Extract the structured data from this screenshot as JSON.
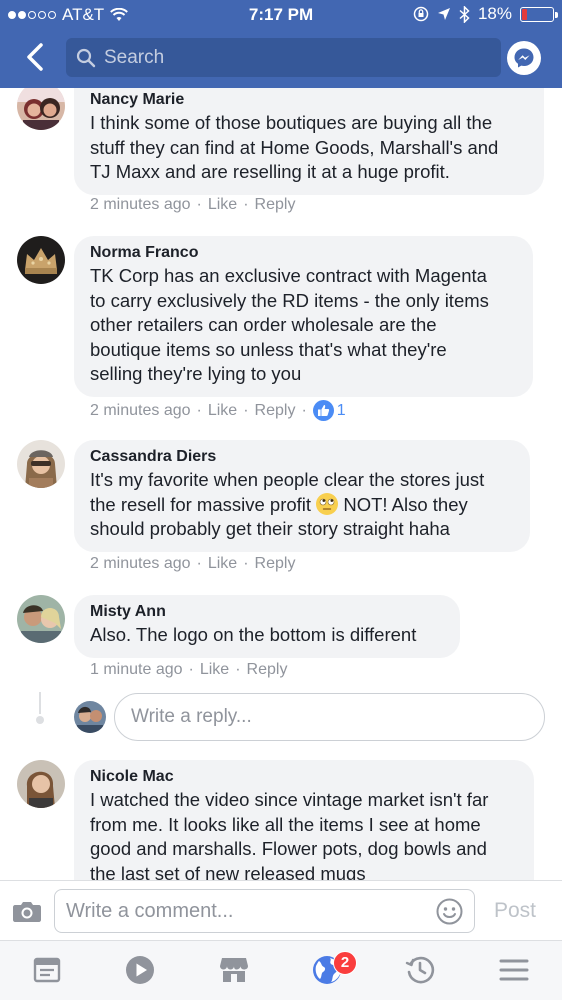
{
  "status_bar": {
    "carrier": "AT&T",
    "time": "7:17 PM",
    "battery": "18%",
    "battery_level": 0.18
  },
  "header": {
    "search_placeholder": "Search"
  },
  "comments": [
    {
      "name": "Nancy Marie",
      "text_lines": [
        "I think some of those boutiques are buying all the",
        "stuff they can find at Home Goods, Marshall's and",
        "TJ Maxx and are reselling it at a huge profit."
      ],
      "time": "2 minutes ago",
      "like": "Like",
      "reply": "Reply",
      "sep": "·"
    },
    {
      "name": "Norma Franco",
      "text_lines": [
        "TK Corp has an exclusive contract with Magenta",
        "to carry exclusively the RD items - the only items",
        "other retailers can order wholesale are the",
        "boutique items so unless that's what they're",
        "selling they're lying to you"
      ],
      "time": "2 minutes ago",
      "like": "Like",
      "reply": "Reply",
      "sep": "·",
      "reactions": "1"
    },
    {
      "name": "Cassandra Diers",
      "text_lines": [
        "It's my favorite when people clear the stores just",
        "the resell for massive profit",
        "NOT! Also they",
        "should probably get their story straight haha"
      ],
      "time": "2 minutes ago",
      "like": "Like",
      "reply": "Reply",
      "sep": "·"
    },
    {
      "name": "Misty Ann",
      "text_lines": [
        "Also. The logo on the bottom is different"
      ],
      "time": "1 minute ago",
      "like": "Like",
      "reply": "Reply",
      "sep": "·"
    },
    {
      "name": "Nicole Mac",
      "text_lines": [
        "I watched the video since vintage market isn't far",
        "from me. It looks like all the items I see at home",
        "good and marshalls. Flower pots, dog bowls and",
        "the last set of new released mugs"
      ]
    }
  ],
  "reply_box": {
    "placeholder": "Write a reply..."
  },
  "composer": {
    "placeholder": "Write a comment...",
    "post_label": "Post"
  },
  "tabbar": {
    "notifications_badge": "2"
  },
  "icons": [
    "back-icon",
    "search-icon",
    "messenger-icon",
    "thumbs-up-icon",
    "rolling-eyes-emoji-icon",
    "camera-icon",
    "smiley-icon",
    "news-feed-icon",
    "video-icon",
    "marketplace-icon",
    "globe-icon",
    "history-icon",
    "menu-icon"
  ],
  "colors": {
    "brand": "#4267b2",
    "search_bg": "#365899",
    "bubble": "#f2f3f5",
    "meta": "#90949c",
    "like_blue": "#4b8cf5",
    "badge": "#fa3e3e"
  }
}
